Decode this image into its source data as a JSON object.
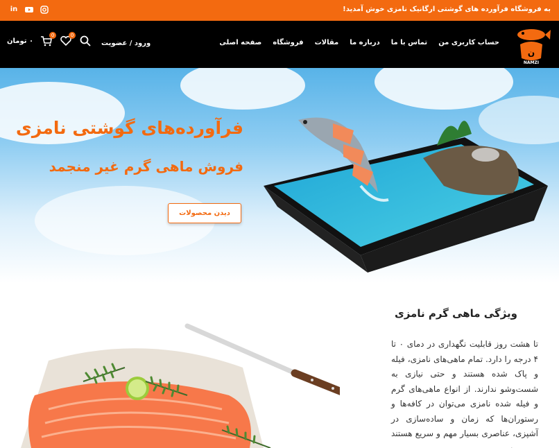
{
  "topbar": {
    "welcome": "به فروشگاه فرآورده های گوشتی ارگانیک نامزی خوش آمدید!",
    "socials": [
      "linkedin-icon",
      "youtube-icon",
      "instagram-icon"
    ]
  },
  "header": {
    "logo_text": "نامزی",
    "logo_sub": "NAMZI",
    "nav": [
      "صفحه اصلی",
      "فروشگاه",
      "مقالات",
      "درباره ما",
      "تماس با ما",
      "حساب کاربری من"
    ],
    "login": "ورود / عضویت",
    "wishlist_count": "0",
    "cart_count": "0",
    "cart_total": "۰ تومان"
  },
  "hero": {
    "title": "فرآورده‌های گوشتی نامزی",
    "subtitle": "فروش ماهی گرم غیر منجمد",
    "button": "دیدن محصولات"
  },
  "features": {
    "title": "ویژگی ماهی گرم نامزی",
    "text": "تا هشت روز قابلیت نگهداری در دمای ۰ تا ۴ درجه را دارد. تمام ماهی‌های نامزی، فیله و پاک شده هستند و حتی نیازی به شست‌وشو ندارند. از انواع ماهی‌های گرم و فیله شده نامزی می‌توان در کافه‌ها و رستوران‌ها که زمان و ساده‌سازی در آشپزی، عناصری بسیار مهم و سریع هستند بهره برد"
  },
  "colors": {
    "accent": "#f36a10",
    "header_bg": "#000000"
  }
}
